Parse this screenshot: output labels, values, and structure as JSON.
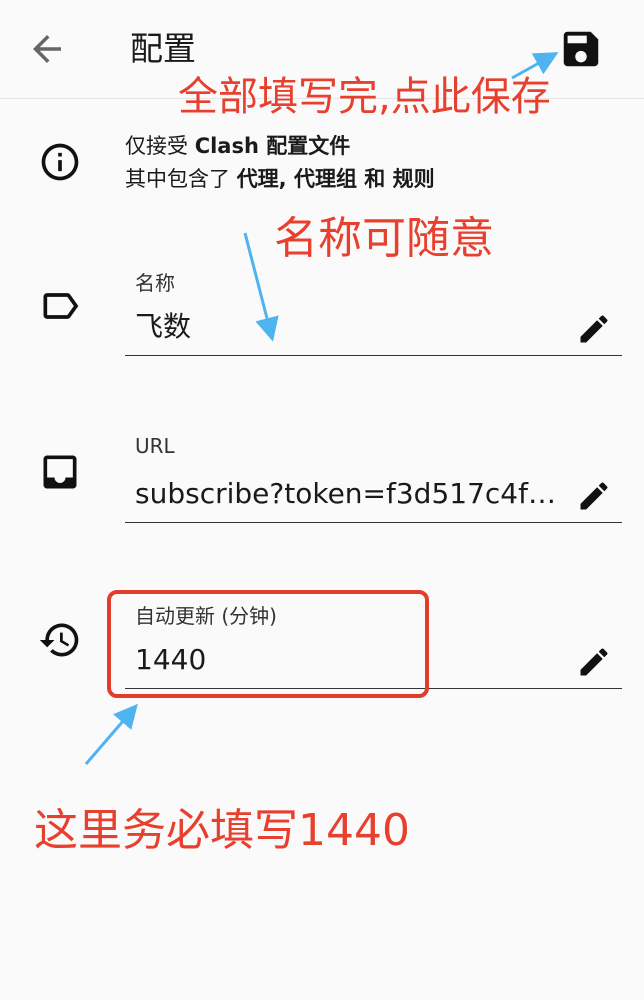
{
  "appbar": {
    "title": "配置",
    "back_icon": "arrow-back-icon",
    "save_icon": "save-icon"
  },
  "info": {
    "icon": "info-icon",
    "line1_prefix": "仅接受 ",
    "line1_bold": "Clash 配置文件",
    "line2_prefix": "其中包含了 ",
    "line2_bold": "代理, 代理组 和 规则"
  },
  "fields": {
    "name": {
      "icon": "label-icon",
      "label": "名称",
      "value": "飞数",
      "edit_icon": "edit-pencil-icon"
    },
    "url": {
      "icon": "inbox-icon",
      "label": "URL",
      "value": "subscribe?token=f3d517c4f…",
      "edit_icon": "edit-pencil-icon"
    },
    "auto_update": {
      "icon": "history-icon",
      "label": "自动更新 (分钟)",
      "value": "1440",
      "edit_icon": "edit-pencil-icon"
    }
  },
  "annotations": {
    "save_hint": "全部填写完,点此保存",
    "name_hint": "名称可随意",
    "interval_hint": "这里务必填写1440"
  },
  "colors": {
    "annotation_text": "#e8402e",
    "annotation_box": "#e23c2a",
    "arrow": "#4fb3f0",
    "background": "#fafafa"
  }
}
